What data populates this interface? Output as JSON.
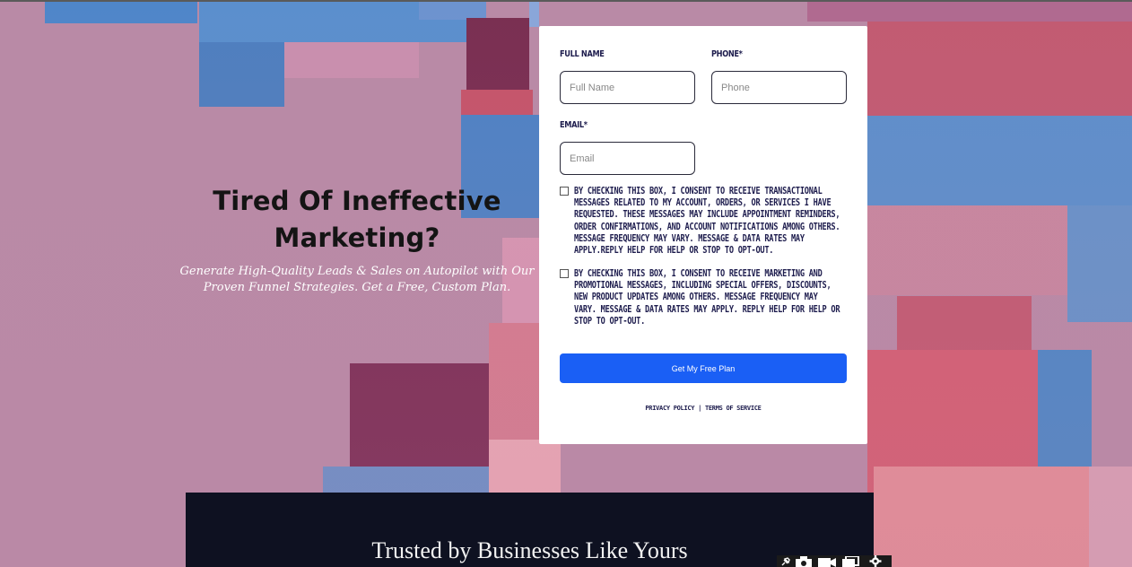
{
  "hero": {
    "title": "Tired Of Ineffective Marketing?",
    "subtitle": "Generate High-Quality Leads & Sales on Autopilot with Our Proven Funnel Strategies. Get a Free, Custom Plan."
  },
  "form": {
    "full_name_label": "FULL NAME",
    "full_name_placeholder": "Full Name",
    "phone_label": "PHONE*",
    "phone_placeholder": "Phone",
    "email_label": "EMAIL*",
    "email_placeholder": "Email",
    "consent_transactional": "By checking this box, I consent to receive transactional messages related to my account, orders, or services I have requested. These messages may include appointment reminders, order confirmations, and account notifications among others. Message frequency may vary. Message & Data rates may apply.Reply HELP for help or STOP to opt-out.",
    "consent_marketing": "By checking this box, I consent to receive marketing and promotional messages, including special offers, discounts, new product updates among others. Message frequency may vary. Message & Data rates may apply. Reply HELP for help or STOP to opt-out.",
    "submit_label": "Get My Free Plan",
    "privacy_link": "PRIVACY POLICY",
    "separator": " | ",
    "terms_link": "TERMS OF SERVICE"
  },
  "trusted": {
    "heading": "Trusted by Businesses Like Yours"
  },
  "tools": [
    "pin-icon",
    "camera-icon",
    "video-icon",
    "copy-icon",
    "gear-icon"
  ],
  "colors": {
    "button": "#1a5ff5",
    "dark_section": "#0e1121",
    "label_text": "#1d1c4d",
    "background_pink": "#b98aa6"
  }
}
